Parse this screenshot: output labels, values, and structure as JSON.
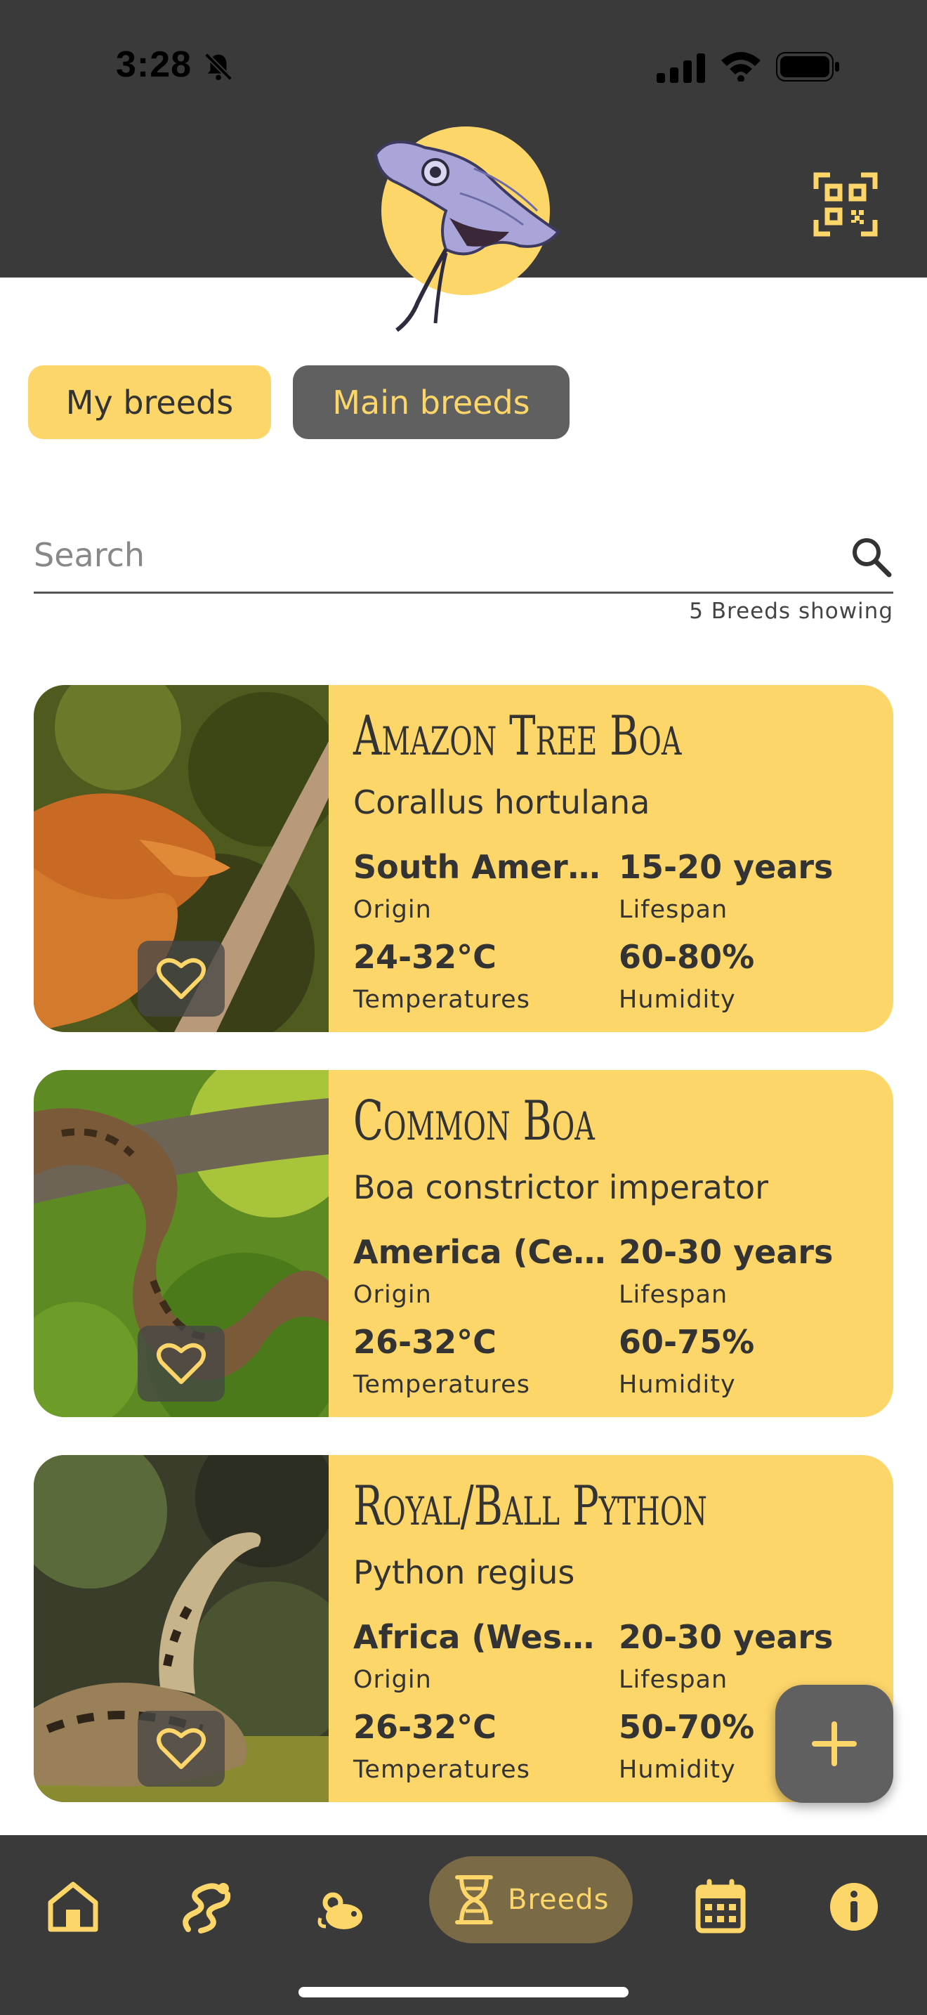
{
  "status": {
    "time": "3:28"
  },
  "tabs": {
    "my_breeds": "My breeds",
    "main_breeds": "Main breeds"
  },
  "search": {
    "placeholder": "Search",
    "count_text": "5 Breeds showing"
  },
  "stat_labels": {
    "origin": "Origin",
    "lifespan": "Lifespan",
    "temperatures": "Temperatures",
    "humidity": "Humidity"
  },
  "breeds": [
    {
      "name": "Amazon Tree Boa",
      "scientific": "Corallus hortulana",
      "origin": "South Americ...",
      "lifespan": "15-20 years",
      "temperatures": "24-32°C",
      "humidity": "60-80%"
    },
    {
      "name": "Common Boa",
      "scientific": "Boa constrictor imperator",
      "origin": "America (Cen...",
      "lifespan": "20-30 years",
      "temperatures": "26-32°C",
      "humidity": "60-75%"
    },
    {
      "name": "Royal/Ball Python",
      "scientific": "Python regius",
      "origin": "Africa (West ...",
      "lifespan": "20-30 years",
      "temperatures": "26-32°C",
      "humidity": "50-70%"
    }
  ],
  "nav": {
    "active_label": "Breeds"
  },
  "colors": {
    "accent": "#fdd66a",
    "dark": "#3a3a3a",
    "tab_inactive": "#606060"
  },
  "icons": [
    "bell-slash-icon",
    "qr-code-icon",
    "search-icon",
    "heart-icon",
    "plus-icon",
    "home-icon",
    "snake-icon",
    "mouse-icon",
    "dna-icon",
    "calendar-icon",
    "info-icon"
  ]
}
